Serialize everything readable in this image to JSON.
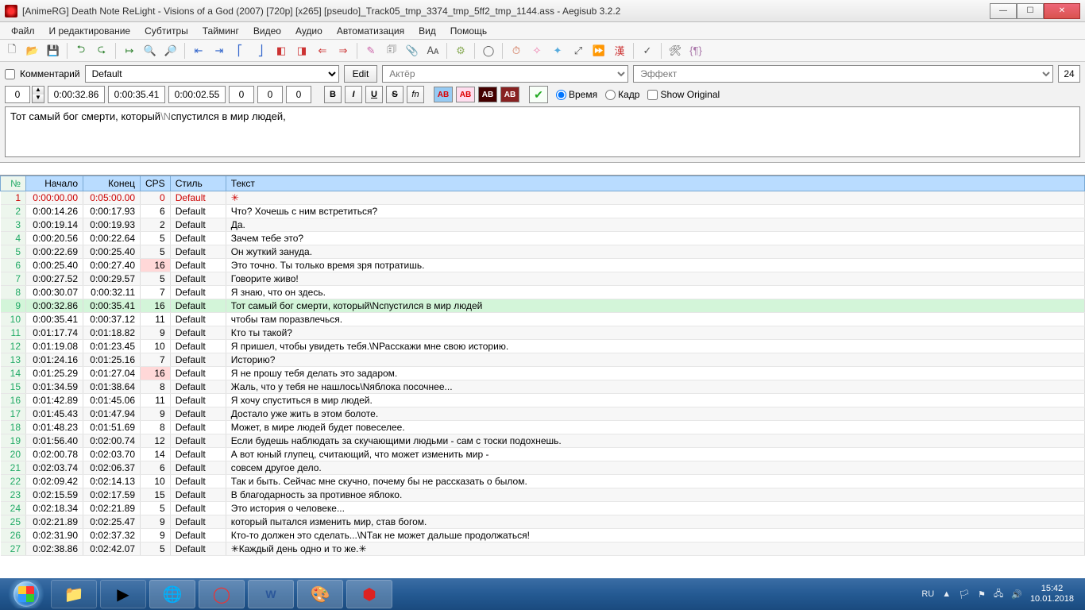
{
  "window": {
    "title": "[AnimeRG] Death Note ReLight - Visions of a God (2007) [720p] [x265] [pseudo]_Track05_tmp_3374_tmp_5ff2_tmp_1144.ass - Aegisub 3.2.2"
  },
  "menu": {
    "file": "Файл",
    "edit": "И редактирование",
    "subtitles": "Субтитры",
    "timing": "Тайминг",
    "video": "Видео",
    "audio": "Аудио",
    "automation": "Автоматизация",
    "view": "Вид",
    "help": "Помощь"
  },
  "editor": {
    "comment_label": "Комментарий",
    "style_value": "Default",
    "edit_btn": "Edit",
    "actor_ph": "Актёр",
    "effect_ph": "Эффект",
    "char_count": "24",
    "layer": "0",
    "start": "0:00:32.86",
    "end": "0:00:35.41",
    "dur": "0:00:02.55",
    "ml": "0",
    "mr": "0",
    "mv": "0",
    "b": "B",
    "i": "I",
    "u": "U",
    "s": "S",
    "fn": "fn",
    "ab1": "AB",
    "ab2": "AB",
    "ab3": "AB",
    "ab4": "AB",
    "time_radio": "Время",
    "frame_radio": "Кадр",
    "show_orig": "Show Original",
    "text_before": "Тот самый бог смерти, который",
    "text_tag": "\\N",
    "text_after": "спустился в мир людей,"
  },
  "grid": {
    "h_num": "№",
    "h_start": "Начало",
    "h_end": "Конец",
    "h_cps": "CPS",
    "h_style": "Стиль",
    "h_text": "Текст",
    "rows": [
      {
        "n": "1",
        "s": "0:00:00.00",
        "e": "0:05:00.00",
        "c": "0",
        "st": "Default",
        "t": "✳",
        "red": true
      },
      {
        "n": "2",
        "s": "0:00:14.26",
        "e": "0:00:17.93",
        "c": "6",
        "st": "Default",
        "t": "Что? Хочешь с ним встретиться?"
      },
      {
        "n": "3",
        "s": "0:00:19.14",
        "e": "0:00:19.93",
        "c": "2",
        "st": "Default",
        "t": "Да."
      },
      {
        "n": "4",
        "s": "0:00:20.56",
        "e": "0:00:22.64",
        "c": "5",
        "st": "Default",
        "t": "Зачем тебе это?"
      },
      {
        "n": "5",
        "s": "0:00:22.69",
        "e": "0:00:25.40",
        "c": "5",
        "st": "Default",
        "t": "Он жуткий зануда."
      },
      {
        "n": "6",
        "s": "0:00:25.40",
        "e": "0:00:27.40",
        "c": "16",
        "st": "Default",
        "t": "Это точно. Ты только время зря потратишь.",
        "hi": true
      },
      {
        "n": "7",
        "s": "0:00:27.52",
        "e": "0:00:29.57",
        "c": "5",
        "st": "Default",
        "t": "Говорите живо!"
      },
      {
        "n": "8",
        "s": "0:00:30.07",
        "e": "0:00:32.11",
        "c": "7",
        "st": "Default",
        "t": "Я знаю, что он здесь."
      },
      {
        "n": "9",
        "s": "0:00:32.86",
        "e": "0:00:35.41",
        "c": "16",
        "st": "Default",
        "t": "Тот самый бог смерти, который\\Nспустился в мир людей",
        "sel": true,
        "hi": true
      },
      {
        "n": "10",
        "s": "0:00:35.41",
        "e": "0:00:37.12",
        "c": "11",
        "st": "Default",
        "t": "чтобы там поразвлечься."
      },
      {
        "n": "11",
        "s": "0:01:17.74",
        "e": "0:01:18.82",
        "c": "9",
        "st": "Default",
        "t": "Кто ты такой?"
      },
      {
        "n": "12",
        "s": "0:01:19.08",
        "e": "0:01:23.45",
        "c": "10",
        "st": "Default",
        "t": "Я пришел, чтобы увидеть тебя.\\NРасскажи мне свою историю."
      },
      {
        "n": "13",
        "s": "0:01:24.16",
        "e": "0:01:25.16",
        "c": "7",
        "st": "Default",
        "t": "Историю?"
      },
      {
        "n": "14",
        "s": "0:01:25.29",
        "e": "0:01:27.04",
        "c": "16",
        "st": "Default",
        "t": "Я не прошу тебя делать это задаром.",
        "hi": true
      },
      {
        "n": "15",
        "s": "0:01:34.59",
        "e": "0:01:38.64",
        "c": "8",
        "st": "Default",
        "t": "Жаль, что у тебя не нашлось\\Nяблока посочнее..."
      },
      {
        "n": "16",
        "s": "0:01:42.89",
        "e": "0:01:45.06",
        "c": "11",
        "st": "Default",
        "t": "Я хочу спуститься в мир людей."
      },
      {
        "n": "17",
        "s": "0:01:45.43",
        "e": "0:01:47.94",
        "c": "9",
        "st": "Default",
        "t": "Достало уже жить в этом болоте."
      },
      {
        "n": "18",
        "s": "0:01:48.23",
        "e": "0:01:51.69",
        "c": "8",
        "st": "Default",
        "t": "Может, в мире людей будет повеселее."
      },
      {
        "n": "19",
        "s": "0:01:56.40",
        "e": "0:02:00.74",
        "c": "12",
        "st": "Default",
        "t": "Если будешь наблюдать за скучающими людьми - сам с тоски подохнешь."
      },
      {
        "n": "20",
        "s": "0:02:00.78",
        "e": "0:02:03.70",
        "c": "14",
        "st": "Default",
        "t": "А вот юный глупец, считающий, что может изменить мир -"
      },
      {
        "n": "21",
        "s": "0:02:03.74",
        "e": "0:02:06.37",
        "c": "6",
        "st": "Default",
        "t": "совсем другое дело."
      },
      {
        "n": "22",
        "s": "0:02:09.42",
        "e": "0:02:14.13",
        "c": "10",
        "st": "Default",
        "t": "Так и быть. Сейчас мне скучно, почему бы не рассказать о былом."
      },
      {
        "n": "23",
        "s": "0:02:15.59",
        "e": "0:02:17.59",
        "c": "15",
        "st": "Default",
        "t": "В благодарность за противное яблоко."
      },
      {
        "n": "24",
        "s": "0:02:18.34",
        "e": "0:02:21.89",
        "c": "5",
        "st": "Default",
        "t": "Это история о человеке..."
      },
      {
        "n": "25",
        "s": "0:02:21.89",
        "e": "0:02:25.47",
        "c": "9",
        "st": "Default",
        "t": "который пытался изменить мир, став богом."
      },
      {
        "n": "26",
        "s": "0:02:31.90",
        "e": "0:02:37.32",
        "c": "9",
        "st": "Default",
        "t": "Кто-то должен это сделать...\\NТак не может дальше продолжаться!"
      },
      {
        "n": "27",
        "s": "0:02:38.86",
        "e": "0:02:42.07",
        "c": "5",
        "st": "Default",
        "t": "✳Каждый день одно и то же.✳"
      }
    ]
  },
  "tray": {
    "lang": "RU",
    "time": "15:42",
    "date": "10.01.2018"
  }
}
